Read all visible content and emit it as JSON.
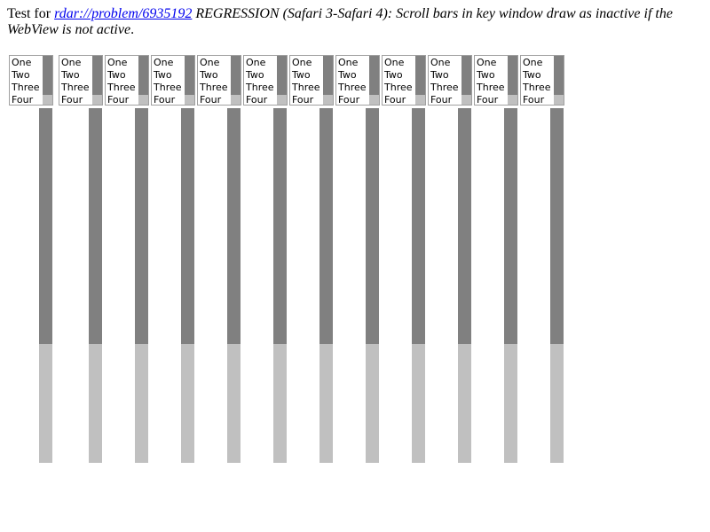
{
  "heading": {
    "prefix": "Test for ",
    "link_text": "rdar://problem/6935192",
    "description": " REGRESSION (Safari 3-Safari 4): Scroll bars in key window draw as inactive if the WebView is not active",
    "suffix": "."
  },
  "listbox_options": [
    "One",
    "Two",
    "Three",
    "Four"
  ],
  "listbox_count": 12,
  "colors": {
    "scrollbar_track": "#c0c0c0",
    "scrollbar_thumb": "#808080",
    "link": "#0000ee"
  }
}
